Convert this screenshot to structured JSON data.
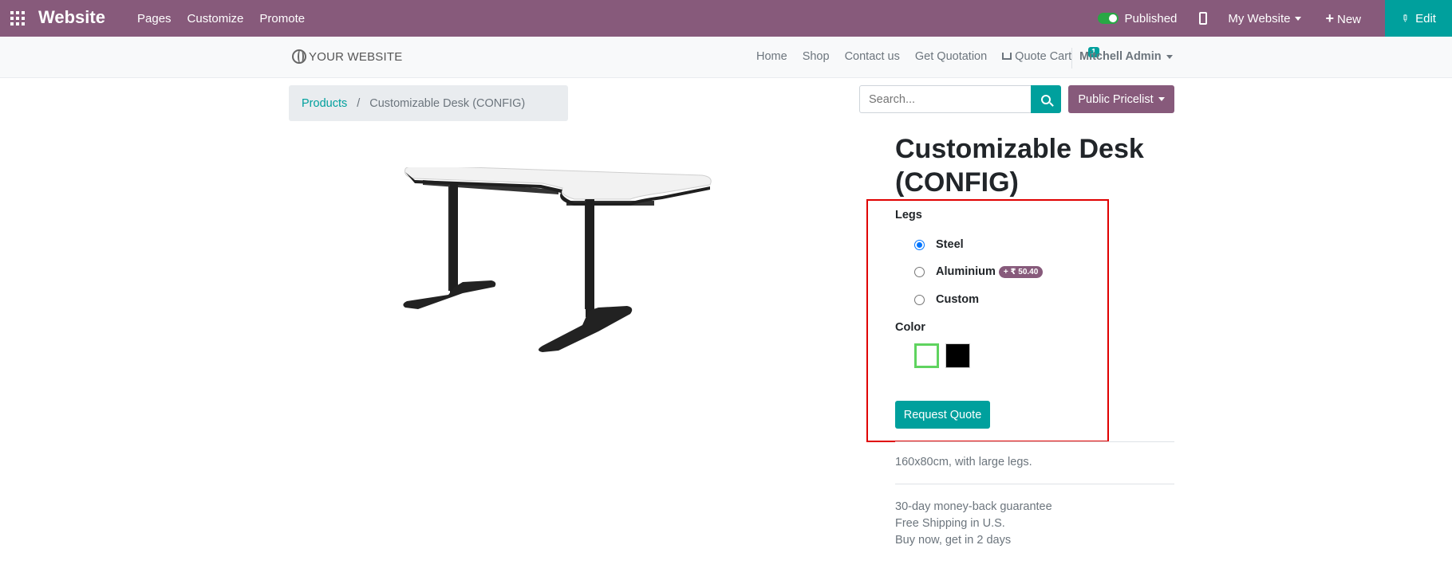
{
  "admin_bar": {
    "app_title": "Website",
    "menu": [
      "Pages",
      "Customize",
      "Promote"
    ],
    "published_label": "Published",
    "my_website_label": "My Website",
    "new_label": "New",
    "edit_label": "Edit",
    "bar_color": "#875A7B",
    "edit_color": "#00A09D"
  },
  "site_nav": {
    "logo_text": "YOUR WEBSITE",
    "links": [
      "Home",
      "Shop",
      "Contact us",
      "Get Quotation"
    ],
    "cart_label": "Quote Cart",
    "cart_count": "1",
    "user_label": "Mitchell Admin"
  },
  "breadcrumb": {
    "parent": "Products",
    "separator": "/",
    "current": "Customizable Desk (CONFIG)"
  },
  "search": {
    "placeholder": "Search..."
  },
  "pricelist_label": "Public Pricelist",
  "product": {
    "title": "Customizable Desk (CONFIG)",
    "legs_label": "Legs",
    "legs_options": [
      {
        "label": "Steel",
        "selected": true
      },
      {
        "label": "Aluminium",
        "extra": "+ ₹ 50.40",
        "selected": false
      },
      {
        "label": "Custom",
        "selected": false
      }
    ],
    "color_label": "Color",
    "colors": [
      "#ffffff",
      "#000000"
    ],
    "selected_color": "#ffffff",
    "request_label": "Request Quote",
    "description": "160x80cm, with large legs.",
    "terms": [
      "30-day money-back guarantee",
      "Free Shipping in U.S.",
      "Buy now, get in 2 days"
    ]
  }
}
